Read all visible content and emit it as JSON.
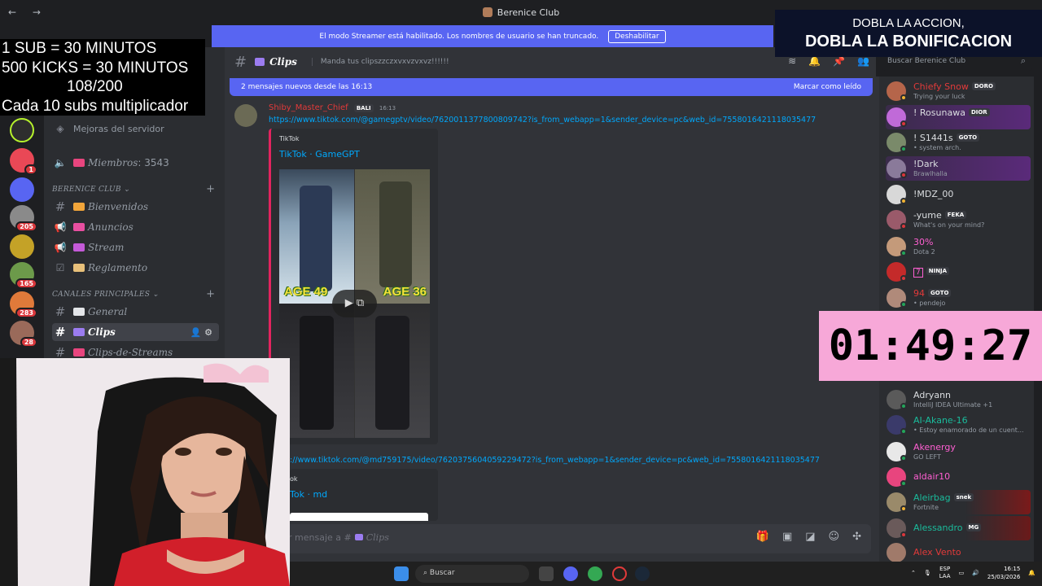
{
  "window": {
    "title": "Berenice Club",
    "nav": "← →"
  },
  "streamer_bar": {
    "text": "El modo Streamer está habilitado. Los nombres de usuario se han truncado.",
    "button": "Deshabilitar"
  },
  "overlay_subs": {
    "lines": [
      "1 SUB     = 30 MINUTOS",
      "500 KICKS = 30 MINUTOS",
      "108/200",
      "Cada 10 subs multiplicador"
    ]
  },
  "promo": {
    "line1": "DOBLA LA ACCION,",
    "line2": "DOBLA LA BONIFICACION"
  },
  "timer": "01:49:27",
  "rail": {
    "badges": [
      "1",
      "205",
      "165",
      "283",
      "28"
    ]
  },
  "channels": {
    "server_boost": "Mejoras del servidor",
    "members_channel": "Miembros",
    "members_count": ": 3543",
    "category1": "BERENICE CLUB ⌄",
    "category2": "CANALES PRINCIPALES ⌄",
    "items": [
      {
        "label": "Bienvenidos"
      },
      {
        "label": "Anuncios"
      },
      {
        "label": "Stream"
      },
      {
        "label": "Reglamento"
      },
      {
        "label": "General"
      },
      {
        "label": "Clips"
      },
      {
        "label": "Clips-de-Streams"
      }
    ]
  },
  "chat_header": {
    "channel": "Clips",
    "topic": "Manda tus clipszzczxvxvzvxvz!!!!!!"
  },
  "search": {
    "placeholder": "Buscar Berenice Club"
  },
  "new_messages": {
    "text": "2 mensajes nuevos desde las 16:13",
    "action": "Marcar como leído"
  },
  "message": {
    "author": "Shiby_Master_Chief",
    "tag": "BALI",
    "time": "16:13",
    "link1": "https://www.tiktok.com/@gamegptv/video/7620011377800809742?is_from_webapp=1&sender_device=pc&web_id=7558016421118035477",
    "embed1_provider": "TikTok",
    "embed1_title": "TikTok · GameGPT",
    "age_left": "AGE 49",
    "age_right": "AGE 36",
    "link2": "://www.tiktok.com/@md759175/video/7620375604059229472?is_from_webapp=1&sender_device=pc&web_id=7558016421118035477",
    "embed2_provider": "ok",
    "embed2_title": "Tok · md"
  },
  "input": {
    "placeholder_prefix": "r mensaje a #",
    "channel": "Clips"
  },
  "members": [
    {
      "name": "Chiefy Snow",
      "tag": "DORO",
      "status": "Trying your luck",
      "color": "#e23a3a"
    },
    {
      "name": "! Rosunawa",
      "tag": "DIOR",
      "status": "",
      "color": "#dbdee1"
    },
    {
      "name": "! S1441s",
      "tag": "GOTO",
      "status": "• system arch.",
      "color": "#dbdee1"
    },
    {
      "name": "!Dark",
      "tag": "",
      "status": "Brawlhalla",
      "color": "#dbdee1"
    },
    {
      "name": "!MDZ_00",
      "tag": "",
      "status": "",
      "color": "#dbdee1"
    },
    {
      "name": "-yume",
      "tag": "FEKA",
      "status": "What's on your mind?",
      "color": "#dbdee1"
    },
    {
      "name": "30%",
      "tag": "",
      "status": "Dota 2",
      "color": "#ff5fd2"
    },
    {
      "name": "7",
      "tag": "NINJA",
      "status": "",
      "color": "#ff5fd2"
    },
    {
      "name": "94",
      "tag": "GOTO",
      "status": "• pendejo",
      "color": "#e23a3a"
    },
    {
      "name": "Adryann",
      "tag": "",
      "status": "IntelliJ IDEA Ultimate +1",
      "color": "#dbdee1"
    },
    {
      "name": "AI-Akane-16",
      "tag": "",
      "status": "• Estoy enamorado de un cuent...",
      "color": "#1abc9c"
    },
    {
      "name": "Akenergy",
      "tag": "",
      "status": "GO LEFT",
      "color": "#ff5fd2"
    },
    {
      "name": "aldair10",
      "tag": "",
      "status": "",
      "color": "#ff5fd2"
    },
    {
      "name": "Aleirbag",
      "tag": "snek",
      "status": "Fortnite",
      "color": "#1abc9c"
    },
    {
      "name": "Alessandro",
      "tag": "MG",
      "status": "",
      "color": "#1abc9c"
    },
    {
      "name": "Alex Vento",
      "tag": "",
      "status": "",
      "color": "#e23a3a"
    }
  ],
  "taskbar": {
    "search": "Buscar",
    "lang": "ESP",
    "lang2": "LAA",
    "time": "16:15",
    "date": "25/03/2026"
  }
}
